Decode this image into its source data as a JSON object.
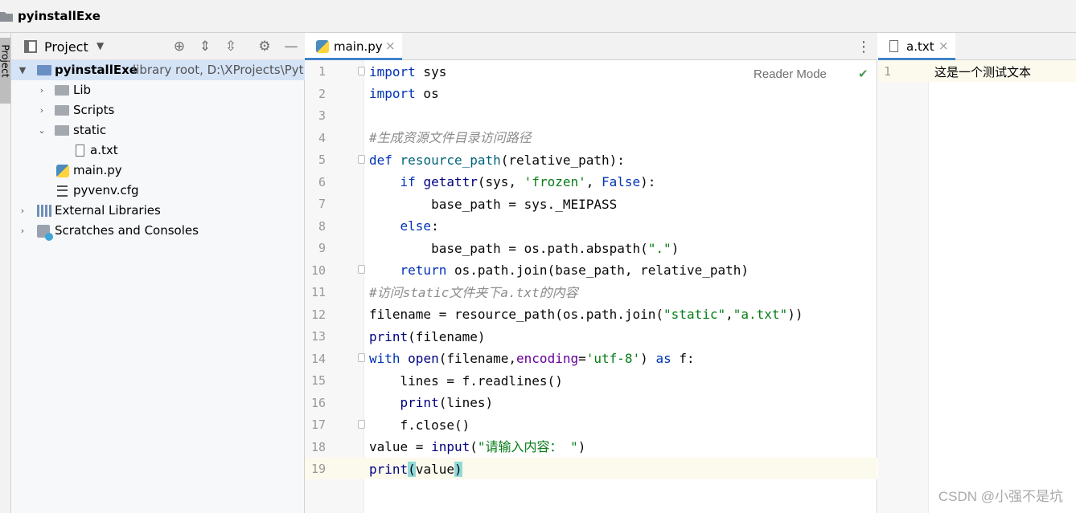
{
  "breadcrumb": {
    "project_name": "pyinstallExe"
  },
  "left_strip": {
    "tab_label": "Project"
  },
  "project_panel": {
    "title": "Project",
    "tree": [
      {
        "label": "pyinstallExe",
        "hint": "library root,  D:\\XProjects\\Pyt",
        "icon": "folder-icon",
        "expanded": true,
        "selected": true
      },
      {
        "label": "Lib",
        "icon": "folder-icon",
        "expanded": false
      },
      {
        "label": "Scripts",
        "icon": "folder-icon",
        "expanded": false
      },
      {
        "label": "static",
        "icon": "folder-icon",
        "expanded": true
      },
      {
        "label": "a.txt",
        "icon": "text-file-icon"
      },
      {
        "label": "main.py",
        "icon": "python-file-icon"
      },
      {
        "label": "pyvenv.cfg",
        "icon": "config-file-icon"
      },
      {
        "label": "External Libraries",
        "icon": "libraries-icon",
        "expanded": false
      },
      {
        "label": "Scratches and Consoles",
        "icon": "scratches-icon",
        "expanded": false
      }
    ]
  },
  "editor": {
    "tab": {
      "label": "main.py",
      "close": "×"
    },
    "reader_mode": "Reader Mode",
    "current_line": 19,
    "line_numbers": [
      "1",
      "2",
      "3",
      "4",
      "5",
      "6",
      "7",
      "8",
      "9",
      "10",
      "11",
      "12",
      "13",
      "14",
      "15",
      "16",
      "17",
      "18",
      "19"
    ]
  },
  "right_editor": {
    "tab": {
      "label": "a.txt",
      "close": "×"
    },
    "line_number": "1",
    "content": "这是一个测试文本"
  },
  "watermark": "CSDN @小强不是坑",
  "colors": {
    "keyword": "#0033b3",
    "string": "#067d17",
    "comment": "#8c8c8c",
    "function": "#00627a",
    "selection": "#d5e3f7"
  }
}
